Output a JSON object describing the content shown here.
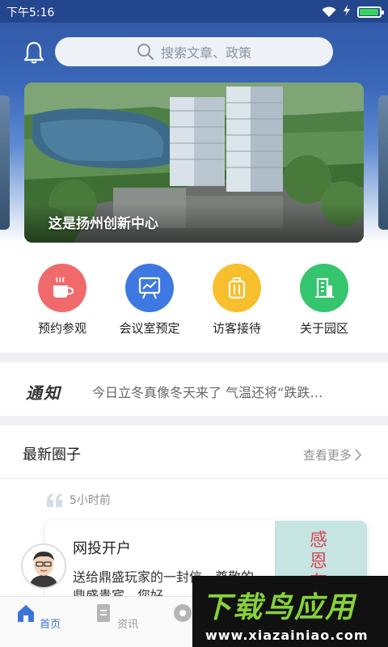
{
  "status_bar": {
    "time": "下午5:16",
    "battery_level": 0.95
  },
  "header": {
    "search": {
      "placeholder": "搜索文章、政策"
    }
  },
  "banner": {
    "caption": "这是扬州创新中心"
  },
  "quick_actions": [
    {
      "label": "预约参观",
      "icon": "coffee-cup-icon",
      "color": "#f06a6c"
    },
    {
      "label": "会议室预定",
      "icon": "presentation-board-icon",
      "color": "#3e78e3"
    },
    {
      "label": "访客接待",
      "icon": "luggage-icon",
      "color": "#f7bf2e"
    },
    {
      "label": "关于园区",
      "icon": "building-icon",
      "color": "#35c56e"
    }
  ],
  "notice": {
    "title": "通知",
    "text": "今日立冬真像冬天来了 气温还将“跌跌…"
  },
  "circle": {
    "title": "最新圈子",
    "more_label": "查看更多"
  },
  "post": {
    "time": "5小时前",
    "author": "网投开户",
    "text": "送给鼎盛玩家的一封信，尊敬的鼎盛贵宾，您好",
    "image_text": "感恩有"
  },
  "tabbar": {
    "tabs": [
      {
        "label": "首页",
        "icon": "home-icon",
        "active": true
      },
      {
        "label": "资讯",
        "icon": "document-icon",
        "active": false
      },
      {
        "label": "圈",
        "icon": "circle-icon",
        "active": false
      }
    ]
  },
  "watermark": {
    "title": "下载鸟应用",
    "url": "www.xiazainiao.com"
  },
  "colors": {
    "accent": "#3b74d9",
    "header_blue": "#2f56a3"
  }
}
